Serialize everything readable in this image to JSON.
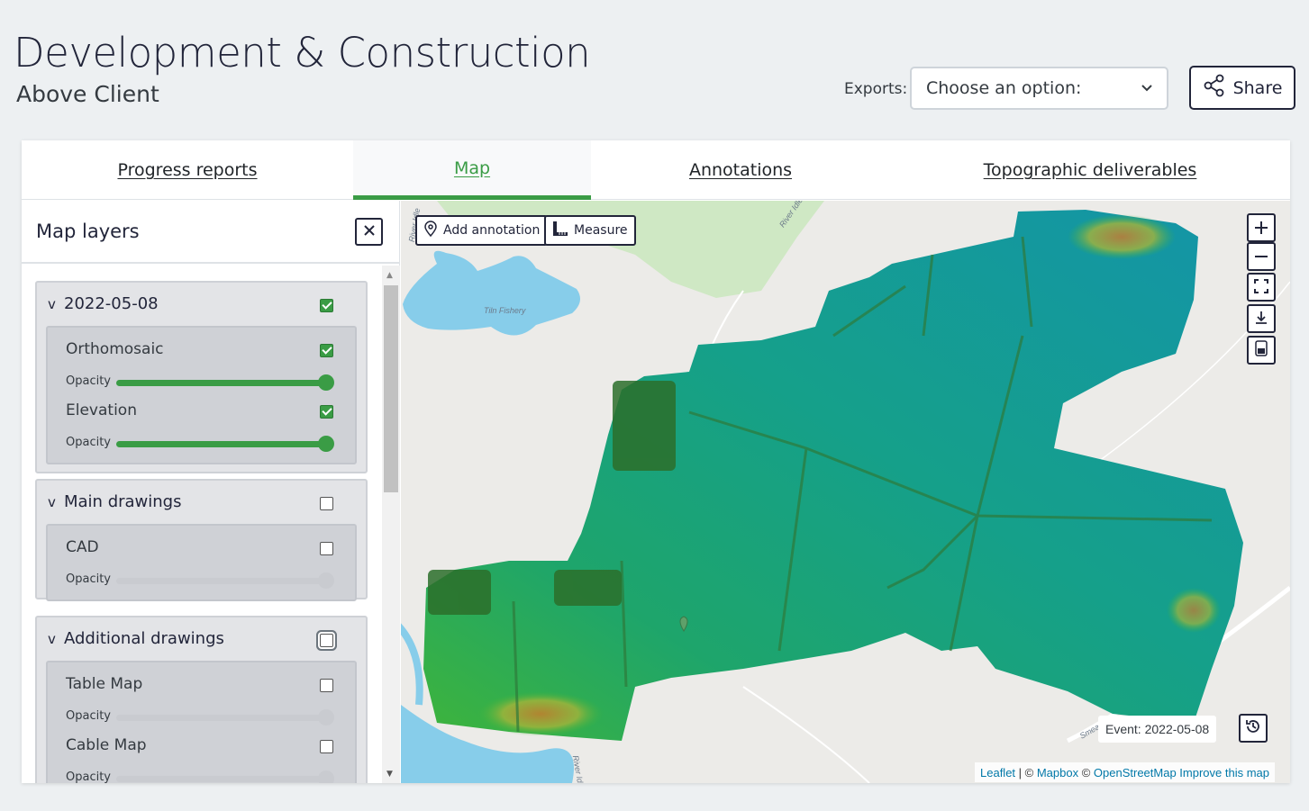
{
  "header": {
    "title": "Development & Construction",
    "subtitle": "Above Client",
    "exports_label": "Exports:",
    "exports_selected": "Choose an option:",
    "share_label": "Share"
  },
  "tabs": [
    {
      "label": "Progress reports",
      "active": false
    },
    {
      "label": "Map",
      "active": true
    },
    {
      "label": "Annotations",
      "active": false
    },
    {
      "label": "Topographic deliverables",
      "active": false
    }
  ],
  "panel": {
    "title": "Map layers",
    "groups": [
      {
        "name": "2022-05-08",
        "checked": true,
        "items": [
          {
            "name": "Orthomosaic",
            "checked": true,
            "opacity_label": "Opacity",
            "opacity": 1.0
          },
          {
            "name": "Elevation",
            "checked": true,
            "opacity_label": "Opacity",
            "opacity": 1.0
          }
        ]
      },
      {
        "name": "Main drawings",
        "checked": false,
        "items": [
          {
            "name": "CAD",
            "checked": false,
            "opacity_label": "Opacity",
            "opacity": 1.0
          }
        ]
      },
      {
        "name": "Additional drawings",
        "checked": false,
        "items": [
          {
            "name": "Table Map",
            "checked": false,
            "opacity_label": "Opacity",
            "opacity": 1.0
          },
          {
            "name": "Cable Map",
            "checked": false,
            "opacity_label": "Opacity",
            "opacity": 1.0
          }
        ]
      }
    ]
  },
  "map": {
    "add_annotation_label": "Add annotation",
    "measure_label": "Measure",
    "event_label": "Event: 2022-05-08",
    "attribution": {
      "leaflet": "Leaflet",
      "sep1": " | © ",
      "mapbox": "Mapbox",
      "sep2": " © ",
      "osm": "OpenStreetMap",
      "improve": " Improve this map"
    },
    "labels": {
      "lake": "Tiln Fishery",
      "river_top": "River Idle",
      "river_left": "River Idle",
      "river_bottom": "River Idle",
      "road": "Smeat..."
    },
    "controls": [
      "zoom-in-icon",
      "zoom-out-icon",
      "fullscreen-icon",
      "download-icon",
      "layer-toggle-icon"
    ]
  },
  "colors": {
    "accent": "#3a9c45",
    "dark": "#22253a",
    "water": "#aad3df"
  }
}
